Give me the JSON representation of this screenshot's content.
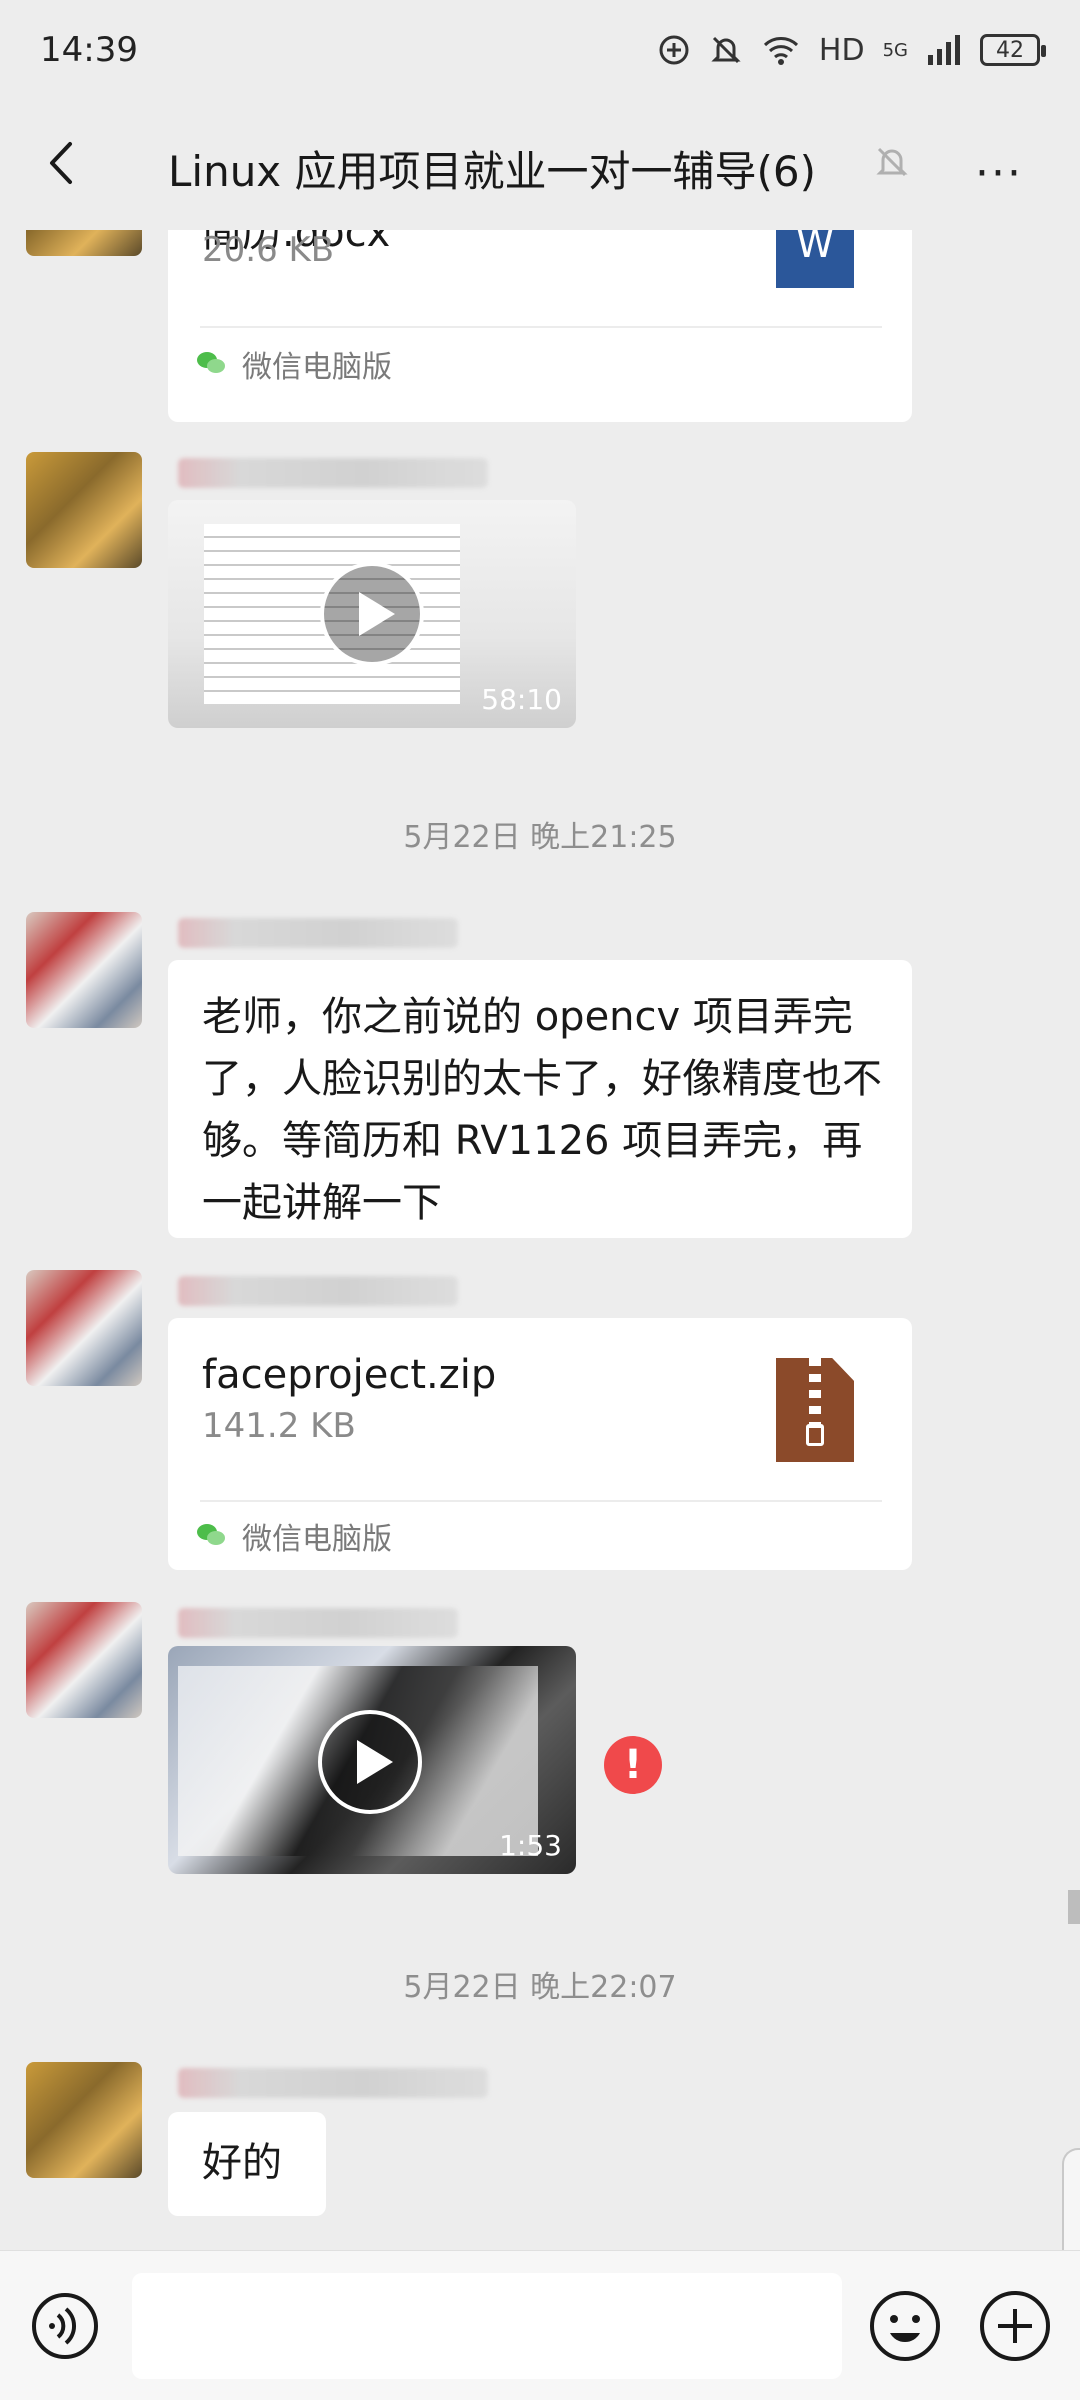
{
  "status_bar": {
    "time": "14:39",
    "network": "HD",
    "signal": "5G",
    "battery": "42"
  },
  "header": {
    "title": "Linux 应用项目就业一对一辅导(6)",
    "more": "···"
  },
  "messages": {
    "file1": {
      "name": "简历.docx",
      "size": "20.6 KB",
      "source": "微信电脑版",
      "icon_label": "W"
    },
    "video1": {
      "duration": "58:10"
    },
    "time1": "5月22日 晚上21:25",
    "text1": "老师，你之前说的 opencv 项目弄完了，人脸识别的太卡了，好像精度也不够。等简历和 RV1126 项目弄完，再一起讲解一下",
    "file2": {
      "name": "faceproject.zip",
      "size": "141.2 KB",
      "source": "微信电脑版"
    },
    "video2": {
      "duration": "1:53",
      "status": "!"
    },
    "time2": "5月22日 晚上22:07",
    "text2": "好的"
  },
  "colors": {
    "background": "#ededed",
    "bubble": "#ffffff",
    "word_blue": "#2b579a",
    "zip_brown": "#8b4a2a",
    "error_red": "#f0494b"
  }
}
